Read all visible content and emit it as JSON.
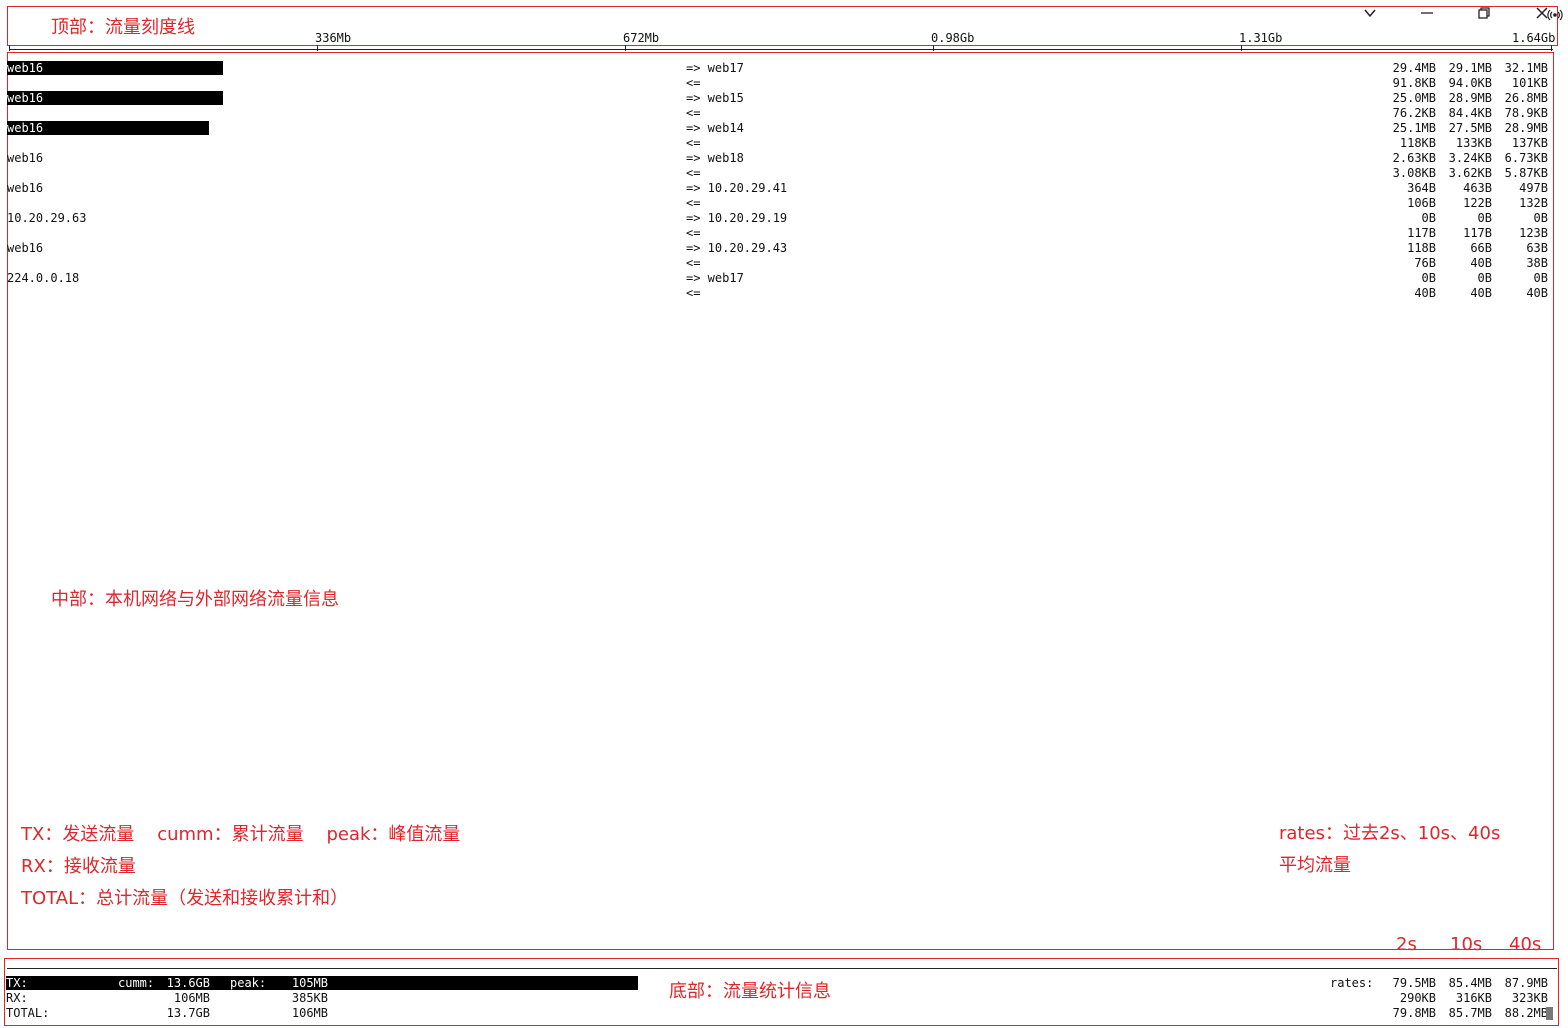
{
  "window": {
    "buttons": [
      {
        "name": "chevron-down-icon",
        "glyph": "⌵"
      },
      {
        "name": "minimize-icon",
        "glyph": "—"
      },
      {
        "name": "restore-icon",
        "glyph": "❐"
      },
      {
        "name": "close-icon",
        "glyph": "✕"
      }
    ]
  },
  "annotations": {
    "top": "顶部：流量刻度线",
    "middle": "中部：本机网络与外部网络流量信息",
    "legend_line1": "TX：发送流量    cumm：累计流量    peak：峰值流量",
    "legend_line2": "RX：接收流量",
    "legend_line3": "TOTAL：总计流量（发送和接收累计和）",
    "rates_line1": "rates：过去2s、10s、40s",
    "rates_line2": "平均流量",
    "col_2s": "2s",
    "col_10s": "10s",
    "col_40s": "40s",
    "bottom": "底部：流量统计信息"
  },
  "scale": {
    "ticks": [
      "336Mb",
      "672Mb",
      "0.98Gb",
      "1.31Gb",
      "1.64Gb"
    ]
  },
  "connections": [
    {
      "src": "web16",
      "dst": "web17",
      "bar": 0.14,
      "tx": [
        "29.4MB",
        "29.1MB",
        "32.1MB"
      ],
      "rx": [
        "91.8KB",
        "94.0KB",
        "101KB"
      ]
    },
    {
      "src": "web16",
      "dst": "web15",
      "bar": 0.14,
      "tx": [
        "25.0MB",
        "28.9MB",
        "26.8MB"
      ],
      "rx": [
        "76.2KB",
        "84.4KB",
        "78.9KB"
      ]
    },
    {
      "src": "web16",
      "dst": "web14",
      "bar": 0.131,
      "tx": [
        "25.1MB",
        "27.5MB",
        "28.9MB"
      ],
      "rx": [
        "118KB",
        "133KB",
        "137KB"
      ]
    },
    {
      "src": "web16",
      "dst": "web18",
      "bar": 0,
      "tx": [
        "2.63KB",
        "3.24KB",
        "6.73KB"
      ],
      "rx": [
        "3.08KB",
        "3.62KB",
        "5.87KB"
      ]
    },
    {
      "src": "web16",
      "dst": "10.20.29.41",
      "bar": 0,
      "tx": [
        "364B",
        "463B",
        "497B"
      ],
      "rx": [
        "106B",
        "122B",
        "132B"
      ]
    },
    {
      "src": "10.20.29.63",
      "dst": "10.20.29.19",
      "bar": 0,
      "tx": [
        "0B",
        "0B",
        "0B"
      ],
      "rx": [
        "117B",
        "117B",
        "123B"
      ]
    },
    {
      "src": "web16",
      "dst": "10.20.29.43",
      "bar": 0,
      "tx": [
        "118B",
        "66B",
        "63B"
      ],
      "rx": [
        "76B",
        "40B",
        "38B"
      ]
    },
    {
      "src": "224.0.0.18",
      "dst": "web17",
      "bar": 0,
      "tx": [
        "0B",
        "0B",
        "0B"
      ],
      "rx": [
        "40B",
        "40B",
        "40B"
      ]
    }
  ],
  "arrows": {
    "out": "=>",
    "in": "<="
  },
  "footer": {
    "tx_label": "TX:",
    "cumm_label": "cumm:",
    "peak_label": "peak:",
    "rx_label": "RX:",
    "total_label": "TOTAL:",
    "rates_label": "rates:",
    "tx_cumm": "13.6GB",
    "tx_peak": "105MB",
    "rx_cumm": "106MB",
    "rx_peak": "385KB",
    "total_cumm": "13.7GB",
    "total_peak": "106MB",
    "tx_rates": [
      "79.5MB",
      "85.4MB",
      "87.9MB"
    ],
    "rx_rates": [
      "290KB",
      "316KB",
      "323KB"
    ],
    "total_rates": [
      "79.8MB",
      "85.7MB",
      "88.2MB"
    ],
    "tx_bar": 0.4
  }
}
